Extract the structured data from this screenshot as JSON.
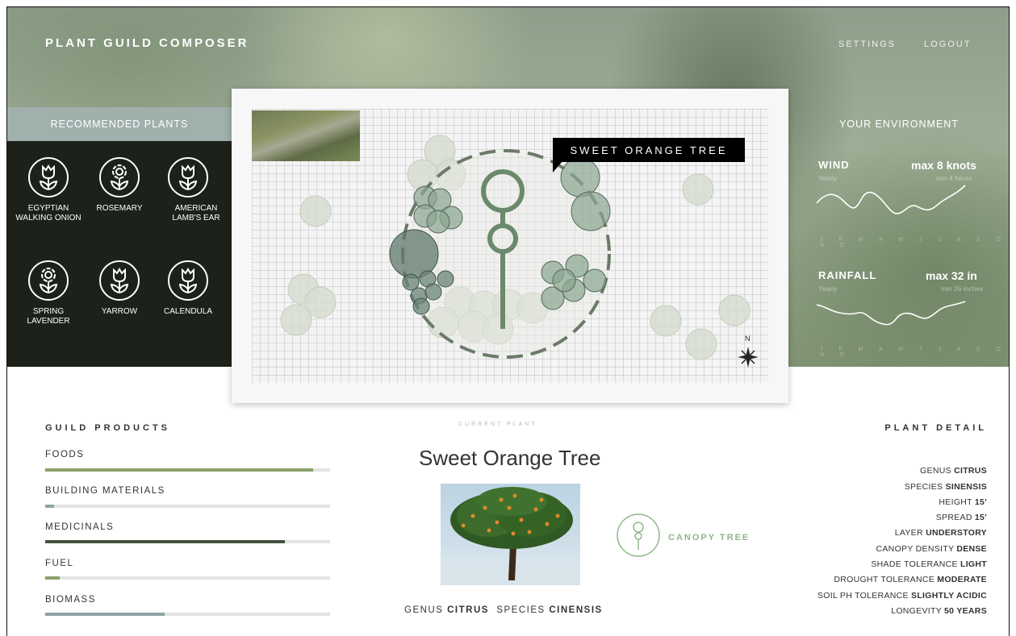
{
  "app": {
    "title": "PLANT GUILD COMPOSER"
  },
  "nav": {
    "settings": "SETTINGS",
    "logout": "LOGOUT"
  },
  "recommended": {
    "title": "RECOMMENDED PLANTS",
    "items": [
      {
        "label": "EGYPTIAN WALKING ONION",
        "icon": "tulip-icon"
      },
      {
        "label": "ROSEMARY",
        "icon": "flower-icon"
      },
      {
        "label": "AMERICAN LAMB'S EAR",
        "icon": "tulip-icon"
      },
      {
        "label": "SPRING LAVENDER",
        "icon": "flower-icon"
      },
      {
        "label": "YARROW",
        "icon": "tulip-icon"
      },
      {
        "label": "CALENDULA",
        "icon": "tulip-icon"
      }
    ]
  },
  "map": {
    "selected_label": "SWEET ORANGE TREE",
    "compass": "N"
  },
  "environment": {
    "title": "YOUR ENVIRONMENT",
    "wind": {
      "label": "WIND",
      "max": "max 8 knots",
      "period": "Yearly",
      "min": "min 4 hours",
      "months": "J F M A M J J A S O N D"
    },
    "rainfall": {
      "label": "RAINFALL",
      "max": "max 32 in",
      "period": "Yearly",
      "min": "min 26 inches",
      "months": "J F M A M J J A S O N D"
    }
  },
  "guild_products": {
    "title": "GUILD PRODUCTS",
    "items": [
      {
        "label": "FOODS",
        "value": 0.94,
        "color": "#8aa06a"
      },
      {
        "label": "BUILDING MATERIALS",
        "value": 0.03,
        "color": "#8fa3a3"
      },
      {
        "label": "MEDICINALS",
        "value": 0.84,
        "color": "#44553d"
      },
      {
        "label": "FUEL",
        "value": 0.05,
        "color": "#8aa06a"
      },
      {
        "label": "BIOMASS",
        "value": 0.42,
        "color": "#8fa3a3"
      }
    ]
  },
  "current_plant": {
    "section": "CURRENT PLANT",
    "name": "Sweet Orange Tree",
    "genus_prefix": "GENUS",
    "genus": "CITRUS",
    "species_prefix": "SPECIES",
    "species": "CINENSIS",
    "layer_badge": "CANOPY TREE",
    "accent_color": "#8fb88a"
  },
  "plant_detail": {
    "title": "PLANT DETAIL",
    "rows": [
      {
        "key": "GENUS",
        "value": "CITRUS"
      },
      {
        "key": "SPECIES",
        "value": "SINENSIS"
      },
      {
        "key": "HEIGHT",
        "value": "15'"
      },
      {
        "key": "SPREAD",
        "value": "15'"
      },
      {
        "key": "LAYER",
        "value": "UNDERSTORY"
      },
      {
        "key": "CANOPY DENSITY",
        "value": "DENSE"
      },
      {
        "key": "SHADE TOLERANCE",
        "value": "LIGHT"
      },
      {
        "key": "DROUGHT TOLERANCE",
        "value": "MODERATE"
      },
      {
        "key": "SOIL PH TOLERANCE",
        "value": "SLIGHTLY ACIDIC"
      },
      {
        "key": "LONGEVITY",
        "value": "50 YEARS"
      }
    ]
  }
}
